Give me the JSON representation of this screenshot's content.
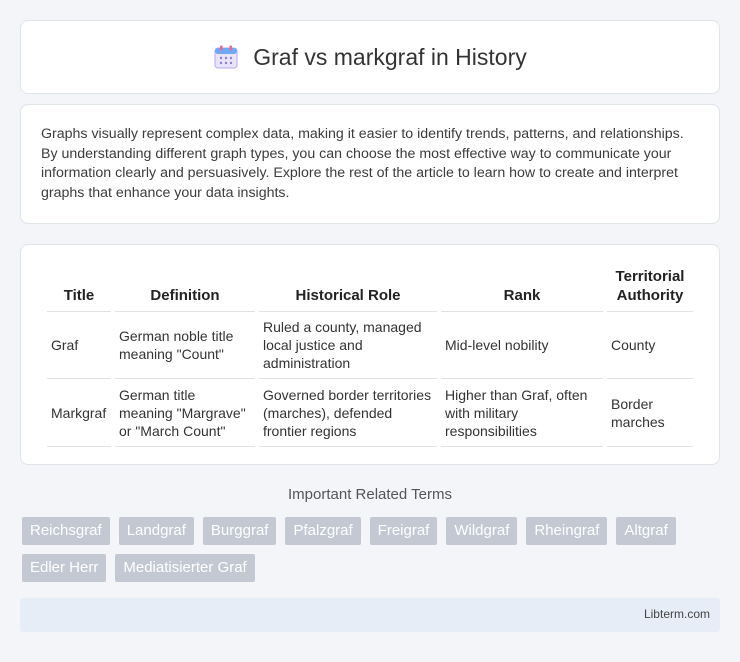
{
  "header": {
    "title": "Graf vs markgraf in History",
    "icon": "calendar-icon"
  },
  "intro": {
    "text": "Graphs visually represent complex data, making it easier to identify trends, patterns, and relationships. By understanding different graph types, you can choose the most effective way to communicate your information clearly and persuasively. Explore the rest of the article to learn how to create and interpret graphs that enhance your data insights."
  },
  "table": {
    "headers": [
      "Title",
      "Definition",
      "Historical Role",
      "Rank",
      "Territorial Authority"
    ],
    "rows": [
      [
        "Graf",
        "German noble title meaning \"Count\"",
        "Ruled a county, managed local justice and administration",
        "Mid-level nobility",
        "County"
      ],
      [
        "Markgraf",
        "German title meaning \"Margrave\" or \"March Count\"",
        "Governed border territories (marches), defended frontier regions",
        "Higher than Graf, often with military responsibilities",
        "Border marches"
      ]
    ]
  },
  "related": {
    "title": "Important Related Terms",
    "tags": [
      "Reichsgraf",
      "Landgraf",
      "Burggraf",
      "Pfalzgraf",
      "Freigraf",
      "Wildgraf",
      "Rheingraf",
      "Altgraf",
      "Edler Herr",
      "Mediatisierter Graf"
    ]
  },
  "footer": {
    "brand": "Libterm.com"
  }
}
